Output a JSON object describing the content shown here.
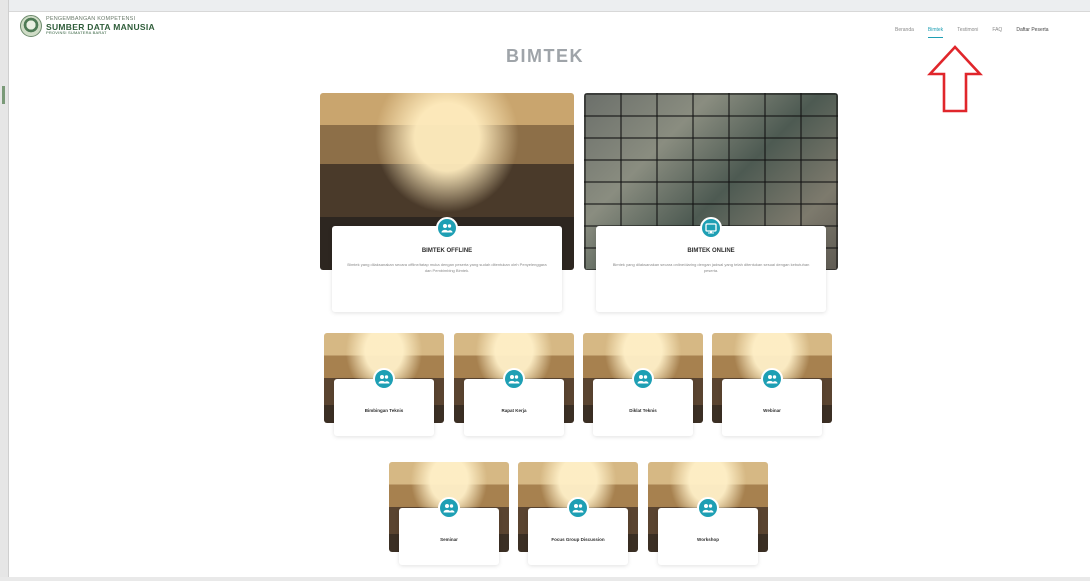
{
  "header": {
    "logo_line1": "PENGEMBANGAN KOMPETENSI",
    "logo_line2": "SUMBER DATA MANUSIA",
    "logo_line3": "PROVINSI SUMATERA BARAT",
    "nav": [
      {
        "label": "Beranda",
        "active": false
      },
      {
        "label": "Bimtek",
        "active": true
      },
      {
        "label": "Testimoni",
        "active": false
      },
      {
        "label": "FAQ",
        "active": false
      },
      {
        "label": "Daftar Peserta",
        "active": false
      }
    ]
  },
  "page_title": "BIMTEK",
  "annotation": {
    "arrow_color": "#e0262b",
    "points_to": "Bimtek"
  },
  "accent_color": "#1e9fb4",
  "main_cards": [
    {
      "title": "BIMTEK OFFLINE",
      "description": "Bimtek yang dilaksanakan secara offline/tatap muka dengan peserta yang sudah ditentukan oleh Penyelenggara dan Pembimbing Bimtek.",
      "icon": "people-icon"
    },
    {
      "title": "BIMTEK ONLINE",
      "description": "Bimtek yang dilaksanakan secara online/daring dengan jadwal yang telah ditentukan sesuai dengan kebutuhan peserta.",
      "icon": "monitor-icon"
    }
  ],
  "sub_cards_row1": [
    {
      "title": "Bimbingan Teknis"
    },
    {
      "title": "Rapat Kerja"
    },
    {
      "title": "Diklat Teknis"
    },
    {
      "title": "Webinar"
    }
  ],
  "sub_cards_row2": [
    {
      "title": "Seminar"
    },
    {
      "title": "Focus Group Discussion"
    },
    {
      "title": "Workshop"
    }
  ]
}
